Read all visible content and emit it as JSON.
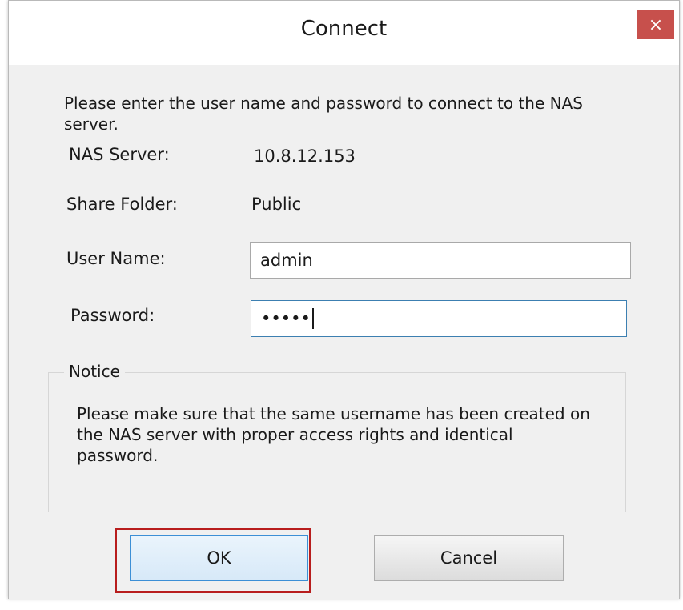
{
  "window": {
    "title": "Connect",
    "close_icon": "×"
  },
  "intro_text": "Please enter the user name and password to connect to the NAS server.",
  "fields": {
    "nas_server_label": "NAS Server:",
    "nas_server_value": "10.8.12.153",
    "share_folder_label": "Share Folder:",
    "share_folder_value": "Public",
    "user_name_label": "User Name:",
    "user_name_value": "admin",
    "password_label": "Password:",
    "password_value": "•••••"
  },
  "notice": {
    "legend": "Notice",
    "text": "Please make sure that the same username has been created on the NAS server with proper access rights and identical password."
  },
  "buttons": {
    "ok_label": "OK",
    "cancel_label": "Cancel"
  },
  "colors": {
    "close_button": "#c7504c",
    "highlight": "#b81d1d",
    "focus_border": "#3c7fb1"
  }
}
